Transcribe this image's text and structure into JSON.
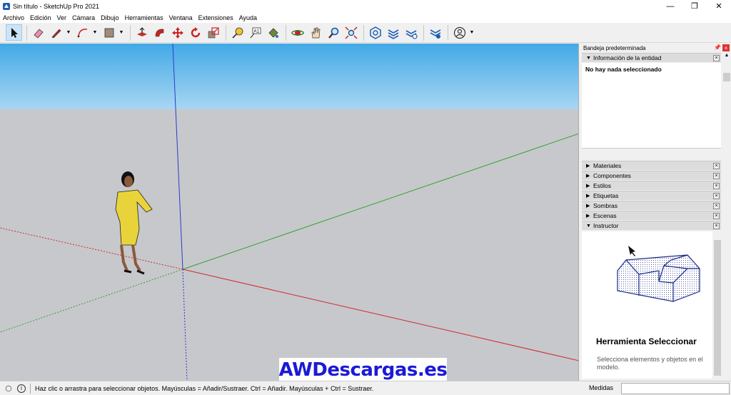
{
  "window": {
    "title": "Sin título - SketchUp Pro 2021",
    "controls": [
      "—",
      "❐",
      "✕"
    ]
  },
  "menu": [
    "Archivo",
    "Edición",
    "Ver",
    "Cámara",
    "Dibujo",
    "Herramientas",
    "Ventana",
    "Extensiones",
    "Ayuda"
  ],
  "toolbar": {
    "tools": [
      "select",
      "eraser",
      "pencil",
      "arc",
      "shapes",
      "push-pull",
      "follow-me",
      "move",
      "rotate",
      "scale",
      "tape-measure",
      "text",
      "paint-bucket",
      "orbit",
      "pan",
      "zoom",
      "zoom-extents",
      "warehouse",
      "extension-warehouse",
      "layout",
      "extension-manager",
      "account"
    ]
  },
  "tray": {
    "title": "Bandeja predeterminada",
    "entity_panel": {
      "label": "Información de la entidad",
      "message": "No hay nada seleccionado"
    },
    "panels": [
      "Materiales",
      "Componentes",
      "Estilos",
      "Etiquetas",
      "Sombras",
      "Escenas",
      "Instructor"
    ],
    "instructor": {
      "title": "Herramienta Seleccionar",
      "description": "Selecciona elementos y objetos en el modelo."
    }
  },
  "viewport": {
    "watermark": "AWDescargas.es",
    "sky_color": "#41a9e6",
    "ground_color": "#c7c8cc"
  },
  "status": {
    "hint": "Haz clic o arrastra para seleccionar objetos. Mayúsculas = Añadir/Sustraer. Ctrl = Añadir. Mayúsculas + Ctrl = Sustraer.",
    "measures_label": "Medidas",
    "measures_value": ""
  }
}
